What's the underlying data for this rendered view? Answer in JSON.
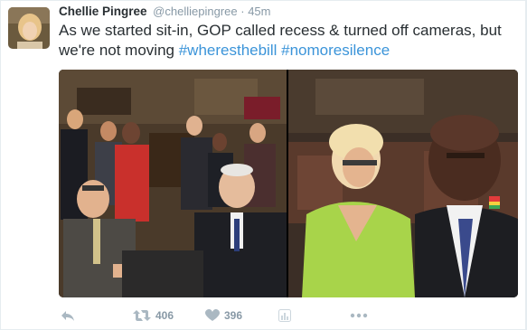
{
  "tweet": {
    "author_name": "Chellie Pingree",
    "author_handle": "@chelliepingree",
    "separator": "·",
    "timestamp": "45m",
    "text": "As we started sit-in, GOP called recess & turned off cameras, but we're not moving",
    "hashtags": [
      "#wheresthebill",
      "#nomoresilence"
    ],
    "media": [
      {
        "name": "photo-house-floor-sit-in"
      },
      {
        "name": "photo-members-seated"
      }
    ]
  },
  "actions": {
    "reply_icon": "reply-icon",
    "retweet_icon": "retweet-icon",
    "retweet_count": "406",
    "like_icon": "heart-icon",
    "like_count": "396",
    "analytics_icon": "analytics-icon",
    "more_icon": "more-icon"
  },
  "colors": {
    "text": "#292f33",
    "muted": "#8899a6",
    "link": "#3b94d9",
    "border": "#e6ecf0"
  }
}
